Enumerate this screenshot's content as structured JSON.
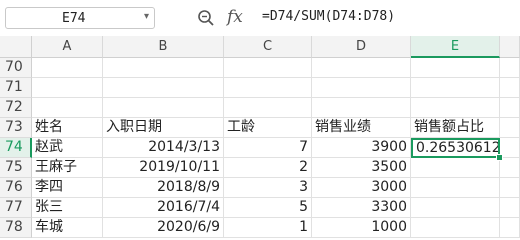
{
  "formula_bar": {
    "name_box": "E74",
    "formula": "=D74/SUM(D74:D78)",
    "icons": [
      "zoom-icon",
      "fx-icon",
      "dropdown-icon"
    ]
  },
  "columns": [
    "A",
    "B",
    "C",
    "D",
    "E"
  ],
  "selected_column": "E",
  "selected_row": "74",
  "rows": [
    {
      "num": "70",
      "cells": [
        "",
        "",
        "",
        "",
        ""
      ]
    },
    {
      "num": "71",
      "cells": [
        "",
        "",
        "",
        "",
        ""
      ]
    },
    {
      "num": "72",
      "cells": [
        "",
        "",
        "",
        "",
        ""
      ]
    },
    {
      "num": "73",
      "cells": [
        "姓名",
        "入职日期",
        "工龄",
        "销售业绩",
        "销售额占比"
      ]
    },
    {
      "num": "74",
      "cells": [
        "赵武",
        "2014/3/13",
        "7",
        "3900",
        "0.26530612"
      ]
    },
    {
      "num": "75",
      "cells": [
        "王麻子",
        "2019/10/11",
        "2",
        "3500",
        ""
      ]
    },
    {
      "num": "76",
      "cells": [
        "李四",
        "2018/8/9",
        "3",
        "3000",
        ""
      ]
    },
    {
      "num": "77",
      "cells": [
        "张三",
        "2016/7/4",
        "5",
        "3300",
        ""
      ]
    },
    {
      "num": "78",
      "cells": [
        "车城",
        "2020/6/9",
        "1",
        "1000",
        ""
      ]
    }
  ],
  "colors": {
    "accent": "#1a9a5e",
    "header_bg": "#f3f3f3",
    "selected_header_bg": "#e3f1ea"
  }
}
